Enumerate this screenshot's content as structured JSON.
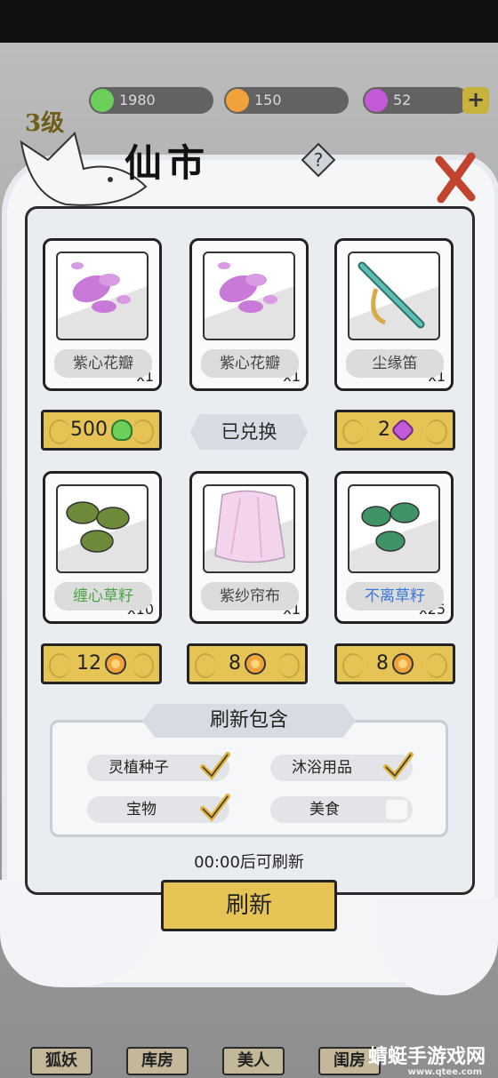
{
  "resources": {
    "leaf": "1980",
    "coin": "150",
    "gem": "52"
  },
  "level": "3级",
  "title": "仙市",
  "items": [
    {
      "name": "紫心花瓣",
      "qty": "x1",
      "price": "500",
      "currency": "leaf-icon"
    },
    {
      "name": "紫心花瓣",
      "qty": "x1",
      "status": "已兑换"
    },
    {
      "name": "尘缘笛",
      "qty": "x1",
      "price": "2",
      "currency": "gem-icon"
    },
    {
      "name": "缠心草籽",
      "qty": "x10",
      "price": "12",
      "currency": "coin-icon"
    },
    {
      "name": "紫纱帘布",
      "qty": "x1",
      "price": "8",
      "currency": "coin-icon"
    },
    {
      "name": "不离草籽",
      "qty": "x25",
      "price": "8",
      "currency": "coin-icon"
    }
  ],
  "refresh_section": {
    "header": "刷新包含",
    "options": [
      {
        "label": "灵植种子",
        "checked": true
      },
      {
        "label": "沐浴用品",
        "checked": true
      },
      {
        "label": "宝物",
        "checked": true
      },
      {
        "label": "美食",
        "checked": false
      }
    ]
  },
  "timer": "00:00后可刷新",
  "refresh_button": "刷新",
  "nav": [
    "狐妖",
    "库房",
    "美人",
    "闺房"
  ],
  "watermark": {
    "main": "蜻蜓手游戏网",
    "sub": "www.qtee.com"
  },
  "colors": {
    "gold": "#e5c455",
    "green_name": "#4aa545",
    "blue_name": "#3a78d8"
  }
}
